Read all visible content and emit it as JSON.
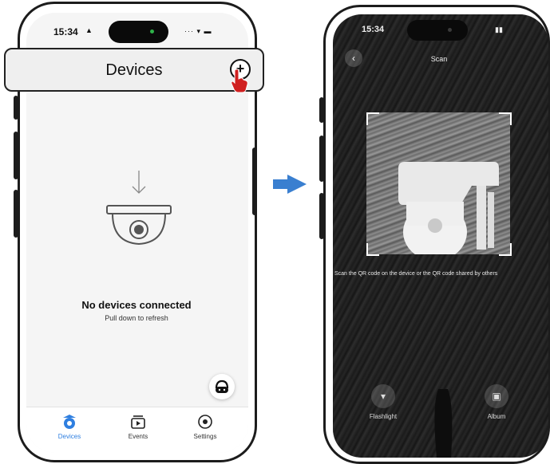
{
  "left_phone": {
    "status": {
      "time": "15:34",
      "icons": "··· ▾ ▬"
    },
    "header": {
      "title": "Devices",
      "add_symbol": "+"
    },
    "empty_state": {
      "title": "No devices connected",
      "subtitle": "Pull down to refresh"
    },
    "tabs": [
      {
        "label": "Devices",
        "icon": "camera-icon",
        "active": true
      },
      {
        "label": "Events",
        "icon": "play-icon",
        "active": false
      },
      {
        "label": "Settings",
        "icon": "settings-icon",
        "active": false
      }
    ],
    "colors": {
      "accent": "#2f7fe0",
      "cursor_hand": "#d01f1f"
    }
  },
  "transition_arrow": {
    "color": "#3a7fd0",
    "icon": "arrow-right-icon"
  },
  "right_phone": {
    "status": {
      "time": "15:34"
    },
    "header": {
      "title": "Scan",
      "back_symbol": "‹"
    },
    "hint": "Scan the QR code on the device or the QR code shared by others",
    "tools": [
      {
        "label": "Flashlight",
        "icon": "flashlight-icon"
      },
      {
        "label": "Album",
        "icon": "album-icon"
      }
    ]
  }
}
